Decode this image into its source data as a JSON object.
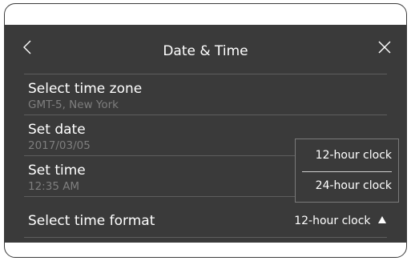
{
  "header": {
    "title": "Date & Time",
    "back_icon": "chevron-left-icon",
    "close_icon": "close-icon"
  },
  "settings": [
    {
      "label": "Select time zone",
      "value": "GMT-5, New York"
    },
    {
      "label": "Set date",
      "value": "2017/03/05"
    },
    {
      "label": "Set time",
      "value": "12:35 AM"
    }
  ],
  "time_format": {
    "label": "Select time format",
    "value": "12-hour clock",
    "arrow_icon": "triangle-up-icon"
  },
  "format_popup": {
    "options": [
      "12-hour clock",
      "24-hour clock"
    ]
  },
  "colors": {
    "screen_bg": "#3a3a3a",
    "text": "#ffffff",
    "secondary_text": "#7e7e7e",
    "divider": "#5e5e5e"
  }
}
